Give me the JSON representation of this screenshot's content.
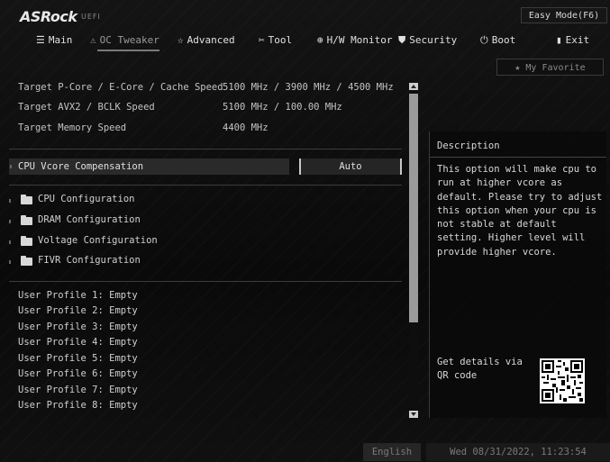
{
  "header": {
    "logo": "ASRock",
    "logo_sub": "UEFI",
    "easy_mode_label": "Easy Mode(F6)"
  },
  "menu": {
    "items": [
      {
        "label": "Main",
        "icon": "list-icon"
      },
      {
        "label": "OC Tweaker",
        "icon": "oc-icon"
      },
      {
        "label": "Advanced",
        "icon": "star-icon"
      },
      {
        "label": "Tool",
        "icon": "tool-icon"
      },
      {
        "label": "H/W Monitor",
        "icon": "monitor-icon"
      },
      {
        "label": "Security",
        "icon": "shield-icon"
      },
      {
        "label": "Boot",
        "icon": "power-icon"
      },
      {
        "label": "Exit",
        "icon": "exit-icon"
      }
    ],
    "active": "OC Tweaker"
  },
  "favorite": {
    "label": "My Favorite"
  },
  "info": [
    {
      "label": "Target P-Core / E-Core / Cache Speed",
      "value": "5100 MHz / 3900 MHz / 4500 MHz"
    },
    {
      "label": "Target AVX2 / BCLK Speed",
      "value": "5100 MHz / 100.00 MHz"
    },
    {
      "label": "Target Memory Speed",
      "value": "4400 MHz"
    }
  ],
  "vcore": {
    "label": "CPU Vcore Compensation",
    "value": "Auto"
  },
  "folders": [
    {
      "label": "CPU Configuration"
    },
    {
      "label": "DRAM Configuration"
    },
    {
      "label": "Voltage Configuration"
    },
    {
      "label": "FIVR Configuration"
    }
  ],
  "profiles": [
    "User Profile 1: Empty",
    "User Profile 2: Empty",
    "User Profile 3: Empty",
    "User Profile 4: Empty",
    "User Profile 5: Empty",
    "User Profile 6: Empty",
    "User Profile 7: Empty",
    "User Profile 8: Empty"
  ],
  "description": {
    "title": "Description",
    "text": "This option will make cpu to run at higher vcore as default. Please try to adjust this option when your cpu is not stable at default setting. Higher level will provide higher vcore.",
    "qr_label": "Get details via QR code"
  },
  "footer": {
    "language": "English",
    "datetime": "Wed 08/31/2022, 11:23:54"
  }
}
